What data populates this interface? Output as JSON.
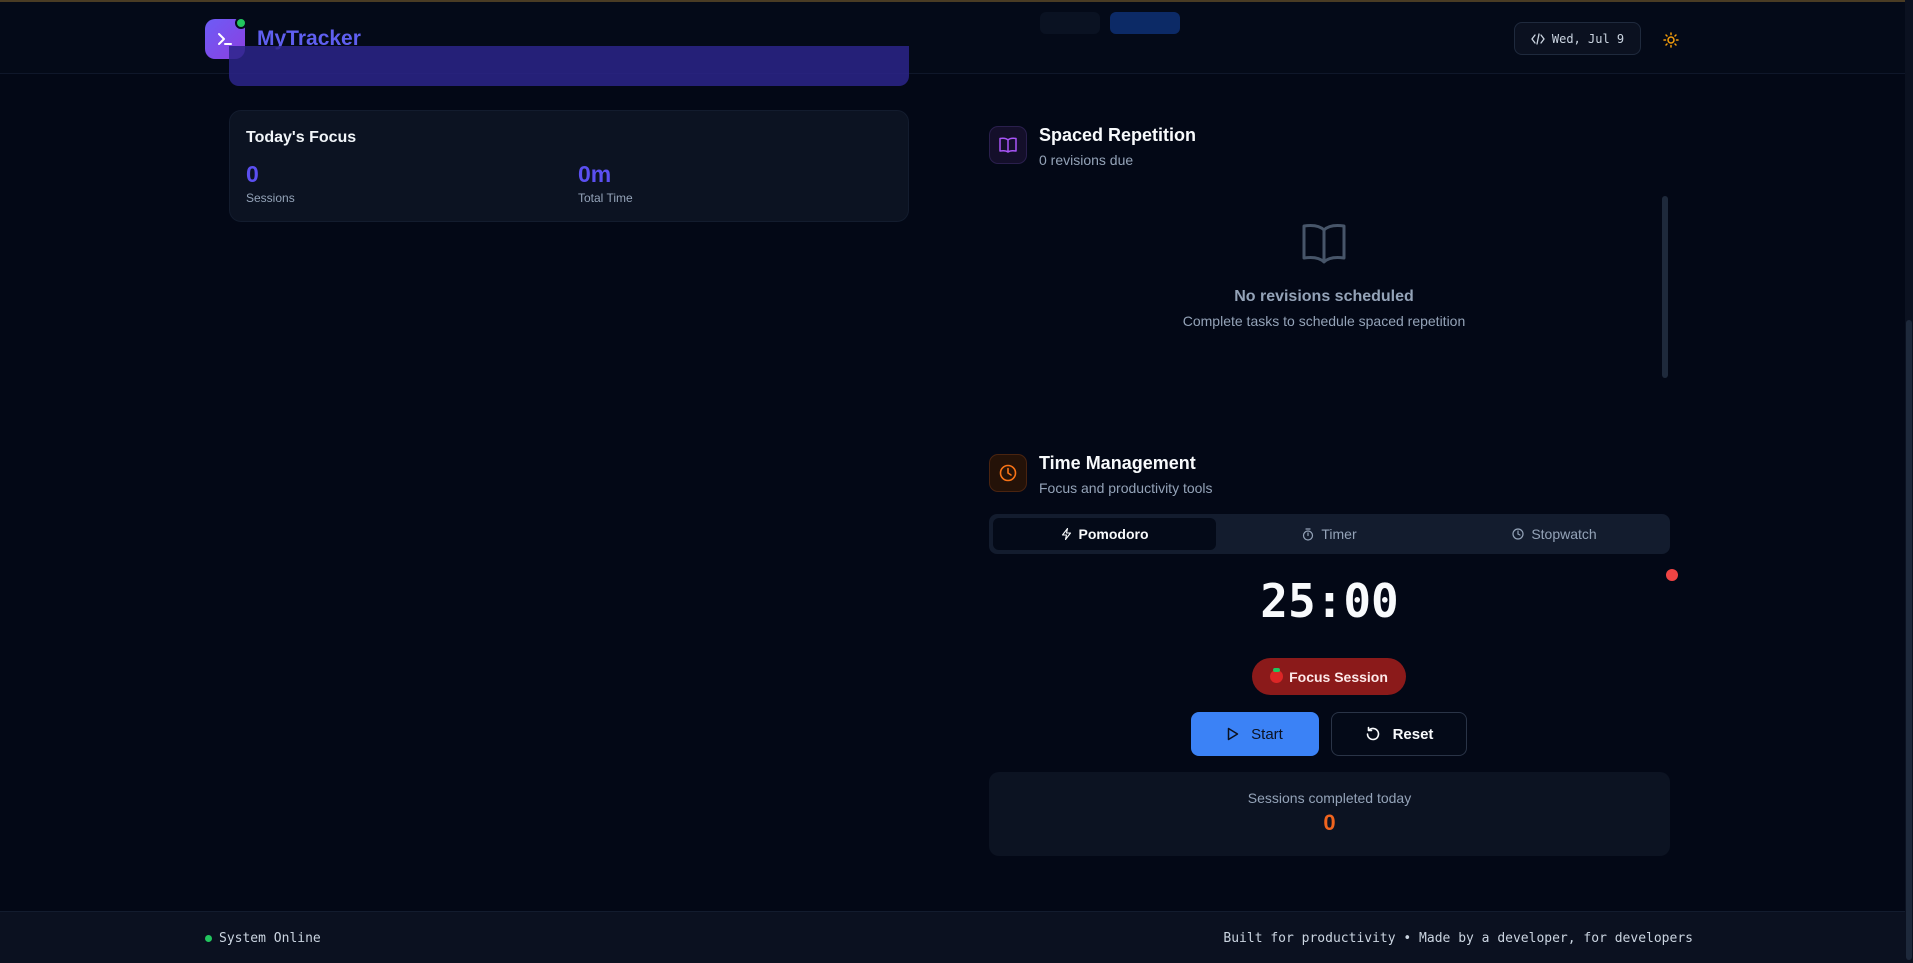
{
  "header": {
    "brand": "MyTracker",
    "date": "Wed, Jul 9"
  },
  "focus": {
    "title": "Today's Focus",
    "sessions_value": "0",
    "sessions_label": "Sessions",
    "time_value": "0m",
    "time_label": "Total Time"
  },
  "spaced_repetition": {
    "title": "Spaced Repetition",
    "subtitle": "0 revisions due",
    "empty_title": "No revisions scheduled",
    "empty_subtitle": "Complete tasks to schedule spaced repetition"
  },
  "time_management": {
    "title": "Time Management",
    "subtitle": "Focus and productivity tools",
    "tabs": [
      {
        "label": "Pomodoro",
        "icon": "zap-icon",
        "active": true
      },
      {
        "label": "Timer",
        "icon": "timer-icon",
        "active": false
      },
      {
        "label": "Stopwatch",
        "icon": "clock-icon",
        "active": false
      }
    ],
    "time_display": "25:00",
    "session_type": "Focus Session",
    "start_label": "Start",
    "reset_label": "Reset",
    "sessions_completed_label": "Sessions completed today",
    "sessions_completed_value": "0"
  },
  "footer": {
    "status": "System Online",
    "tagline": "Built for productivity • Made by a developer, for developers"
  },
  "colors": {
    "background": "#030816",
    "brand": "#5f5ff0",
    "accent_blue": "#3b82f6",
    "focus_red": "#8b1a1a",
    "sessions_orange": "#f0641e",
    "online_green": "#22c55e"
  }
}
